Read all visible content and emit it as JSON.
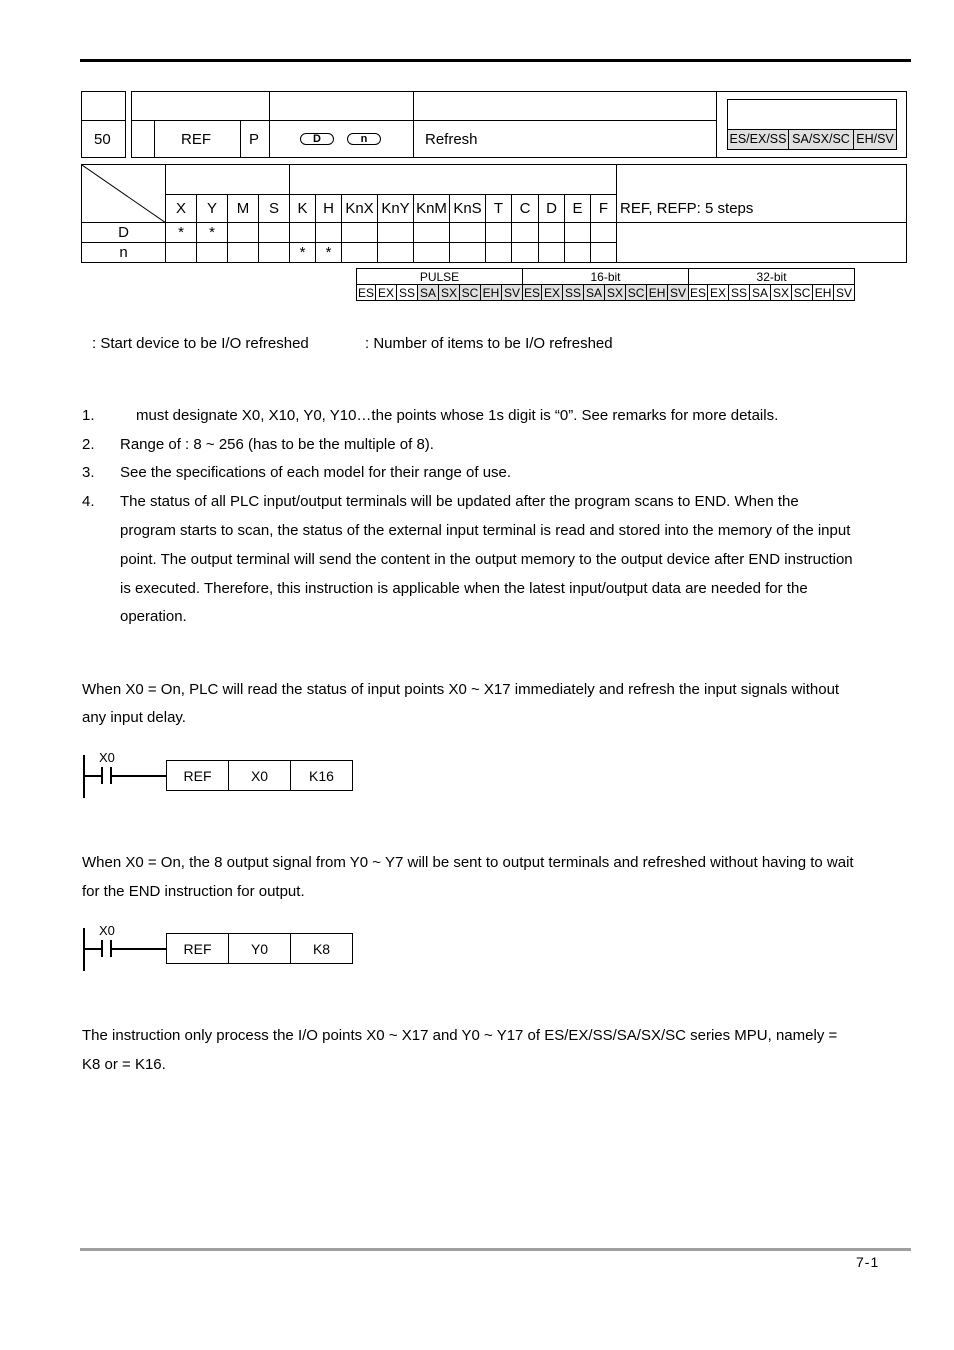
{
  "header": {
    "api_number": "50",
    "mnemonic": "REF",
    "pulse_suffix": "P",
    "operands": [
      "D",
      "n"
    ],
    "function": "Refresh",
    "controllers": [
      "ES/EX/SS",
      "SA/SX/SC",
      "EH/SV"
    ]
  },
  "operand_table": {
    "columns": [
      "X",
      "Y",
      "M",
      "S",
      "K",
      "H",
      "KnX",
      "KnY",
      "KnM",
      "KnS",
      "T",
      "C",
      "D",
      "E",
      "F"
    ],
    "rows": [
      {
        "label": "D",
        "marks": [
          "*",
          "*",
          "",
          "",
          "",
          "",
          "",
          "",
          "",
          "",
          "",
          "",
          "",
          "",
          ""
        ]
      },
      {
        "label": "n",
        "marks": [
          "",
          "",
          "",
          "",
          "*",
          "*",
          "",
          "",
          "",
          "",
          "",
          "",
          "",
          "",
          ""
        ]
      }
    ],
    "steps": "REF, REFP: 5 steps"
  },
  "support_table": {
    "groups": [
      {
        "label": "PULSE",
        "models": [
          "ES",
          "EX",
          "SS",
          "SA",
          "SX",
          "SC",
          "EH",
          "SV"
        ],
        "shaded": [
          false,
          false,
          false,
          true,
          true,
          true,
          true,
          true
        ]
      },
      {
        "label": "16-bit",
        "models": [
          "ES",
          "EX",
          "SS",
          "SA",
          "SX",
          "SC",
          "EH",
          "SV"
        ],
        "shaded": [
          true,
          true,
          true,
          true,
          true,
          true,
          true,
          true
        ]
      },
      {
        "label": "32-bit",
        "models": [
          "ES",
          "EX",
          "SS",
          "SA",
          "SX",
          "SC",
          "EH",
          "SV"
        ],
        "shaded": [
          false,
          false,
          false,
          false,
          false,
          false,
          false,
          false
        ]
      }
    ]
  },
  "operands_desc": {
    "d": ": Start device to be I/O refreshed",
    "n": ": Number of items to be I/O refreshed"
  },
  "notes": [
    {
      "num": "1.",
      "text": "must designate X0, X10, Y0, Y10…the points whose 1s digit is “0”. See remarks for more details."
    },
    {
      "num": "2.",
      "text": "Range of   : 8 ~ 256 (has to be the multiple of 8)."
    },
    {
      "num": "3.",
      "text": "See the specifications of each model for their range of use."
    },
    {
      "num": "4.",
      "lines": [
        "The status of all PLC input/output terminals will be updated after the program scans to END. When the",
        "program starts to scan, the status of the external input terminal is read and stored into the memory of the input",
        "point. The output terminal will send the content in the output memory to the output device after END instruction",
        "is executed. Therefore, this instruction is applicable when the latest input/output data are needed for the",
        "operation."
      ]
    }
  ],
  "example1": {
    "lines": [
      "When X0 = On, PLC will read the status of input points X0 ~ X17 immediately and refresh the input signals without",
      "any input delay."
    ],
    "ladder": {
      "contact": "X0",
      "cells": [
        "REF",
        "X0",
        "K16"
      ]
    }
  },
  "example2": {
    "lines": [
      "When X0 = On, the 8 output signal from Y0 ~ Y7 will be sent to output terminals and refreshed without having to wait",
      "for the END instruction for output."
    ],
    "ladder": {
      "contact": "X0",
      "cells": [
        "REF",
        "Y0",
        "K8"
      ]
    }
  },
  "remarks": {
    "lines": [
      "The instruction only process the I/O points X0 ~ X17 and Y0 ~ Y17 of ES/EX/SS/SA/SX/SC series MPU, namely    =",
      "K8 or    = K16."
    ]
  },
  "footer": {
    "page": "7-1"
  }
}
